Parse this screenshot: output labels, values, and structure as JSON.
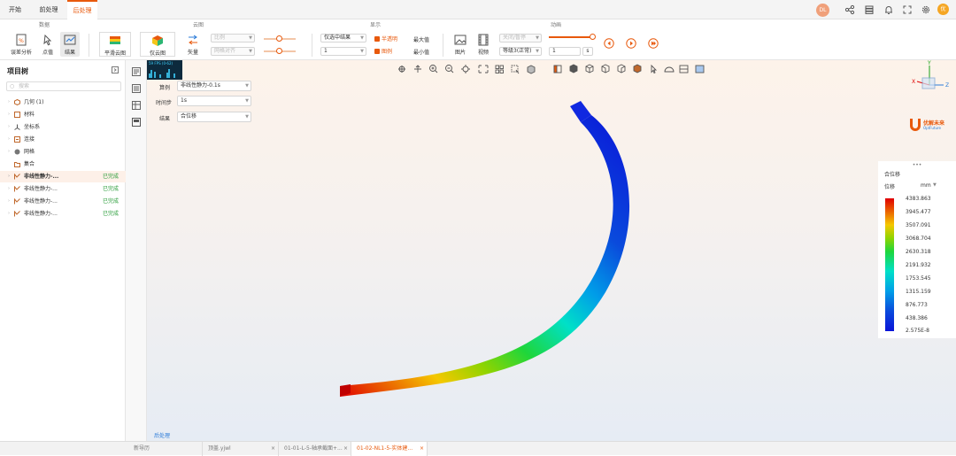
{
  "menu": {
    "tabs": [
      {
        "label": "开始"
      },
      {
        "label": "前处理"
      },
      {
        "label": "后处理"
      }
    ],
    "avatar": "优"
  },
  "ribbon": {
    "groups": {
      "data": "数据",
      "cloud": "云图",
      "display": "显示",
      "animation": "动画"
    },
    "buttons": {
      "error_analysis": "误差分析",
      "point_value": "点值",
      "result": "结果",
      "smooth_cloud": "平滑云图",
      "cloud_only": "仅云图",
      "vector": "矢量",
      "picture": "图片",
      "video": "视频"
    },
    "scale": {
      "placeholder1": "比例",
      "placeholder2": "网格对齐"
    },
    "display": {
      "select": "仅选中结果",
      "num": "1",
      "transparent": "半透明",
      "legend": "图例",
      "max": "最大值",
      "min": "最小值"
    },
    "animation": {
      "select": "关闭/暂停",
      "level": "等级3(正常)",
      "value": "1",
      "unit": "s",
      "slider": 1.0
    }
  },
  "sidebar": {
    "title": "项目树",
    "search_placeholder": "搜索",
    "items": [
      {
        "label": "几何 (1)",
        "status": ""
      },
      {
        "label": "材料",
        "status": ""
      },
      {
        "label": "坐标系",
        "status": ""
      },
      {
        "label": "连接",
        "status": ""
      },
      {
        "label": "网格",
        "status": ""
      },
      {
        "label": "集合",
        "status": ""
      },
      {
        "label": "非线性静力-...",
        "status": "已完成"
      },
      {
        "label": "非线性静力-...",
        "status": "已完成"
      },
      {
        "label": "非线性静力-...",
        "status": "已完成"
      },
      {
        "label": "非线性静力-...",
        "status": "已完成"
      }
    ]
  },
  "viewport": {
    "case_label": "算例",
    "case_value": "非线性静力-0.1s",
    "step_label": "时间步",
    "step_value": "1s",
    "result_label": "结果",
    "result_value": "合位移",
    "watermark": "后处理",
    "fps": "59 FPS (0-62)",
    "axes": {
      "x": "X",
      "y": "Y",
      "z": "Z"
    },
    "brand_name": "优解未来",
    "brand_sub": "OptFuture",
    "legend": {
      "title": "合位移",
      "qty": "位移",
      "unit": "mm",
      "values": [
        "4383.863",
        "3945.477",
        "3507.091",
        "3068.704",
        "2630.318",
        "2191.932",
        "1753.545",
        "1315.159",
        "876.773",
        "438.386",
        "2.575E-8"
      ]
    }
  },
  "bottom": {
    "tabs": [
      {
        "label": "新导历"
      },
      {
        "label": "顶盖.yjwl"
      },
      {
        "label": "01-01-L-5-轴承截面+..."
      },
      {
        "label": "01-02-NL1-5-实体建..."
      }
    ]
  },
  "colors": {
    "accent": "#e8590c",
    "ok": "#2a9d3a",
    "max": "#e00000",
    "min": "#0a14d8"
  }
}
